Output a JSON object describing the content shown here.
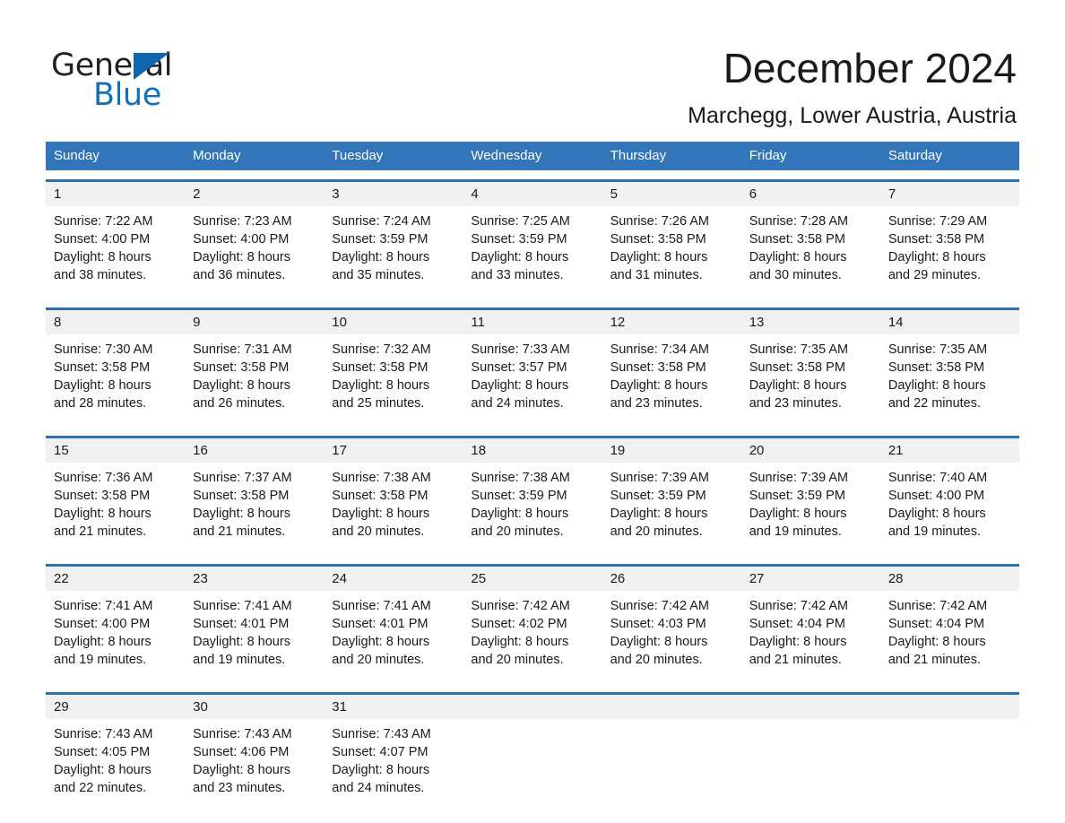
{
  "brand": {
    "word_one": "General",
    "word_two": "Blue",
    "triangle_icon": "triangle-icon",
    "accent_blue": "#1271bd",
    "dark_text": "#231f20"
  },
  "header": {
    "month_title": "December 2024",
    "location": "Marchegg, Lower Austria, Austria"
  },
  "theme": {
    "header_row_bg": "#3275b8",
    "week_rule": "#2e6fb0",
    "date_band_bg": "#f1f1f1",
    "page_bg": "#ffffff"
  },
  "weekdays": [
    "Sunday",
    "Monday",
    "Tuesday",
    "Wednesday",
    "Thursday",
    "Friday",
    "Saturday"
  ],
  "weeks": [
    [
      {
        "day": "1",
        "sunrise": "Sunrise: 7:22 AM",
        "sunset": "Sunset: 4:00 PM",
        "daylight1": "Daylight: 8 hours",
        "daylight2": "and 38 minutes."
      },
      {
        "day": "2",
        "sunrise": "Sunrise: 7:23 AM",
        "sunset": "Sunset: 4:00 PM",
        "daylight1": "Daylight: 8 hours",
        "daylight2": "and 36 minutes."
      },
      {
        "day": "3",
        "sunrise": "Sunrise: 7:24 AM",
        "sunset": "Sunset: 3:59 PM",
        "daylight1": "Daylight: 8 hours",
        "daylight2": "and 35 minutes."
      },
      {
        "day": "4",
        "sunrise": "Sunrise: 7:25 AM",
        "sunset": "Sunset: 3:59 PM",
        "daylight1": "Daylight: 8 hours",
        "daylight2": "and 33 minutes."
      },
      {
        "day": "5",
        "sunrise": "Sunrise: 7:26 AM",
        "sunset": "Sunset: 3:58 PM",
        "daylight1": "Daylight: 8 hours",
        "daylight2": "and 31 minutes."
      },
      {
        "day": "6",
        "sunrise": "Sunrise: 7:28 AM",
        "sunset": "Sunset: 3:58 PM",
        "daylight1": "Daylight: 8 hours",
        "daylight2": "and 30 minutes."
      },
      {
        "day": "7",
        "sunrise": "Sunrise: 7:29 AM",
        "sunset": "Sunset: 3:58 PM",
        "daylight1": "Daylight: 8 hours",
        "daylight2": "and 29 minutes."
      }
    ],
    [
      {
        "day": "8",
        "sunrise": "Sunrise: 7:30 AM",
        "sunset": "Sunset: 3:58 PM",
        "daylight1": "Daylight: 8 hours",
        "daylight2": "and 28 minutes."
      },
      {
        "day": "9",
        "sunrise": "Sunrise: 7:31 AM",
        "sunset": "Sunset: 3:58 PM",
        "daylight1": "Daylight: 8 hours",
        "daylight2": "and 26 minutes."
      },
      {
        "day": "10",
        "sunrise": "Sunrise: 7:32 AM",
        "sunset": "Sunset: 3:58 PM",
        "daylight1": "Daylight: 8 hours",
        "daylight2": "and 25 minutes."
      },
      {
        "day": "11",
        "sunrise": "Sunrise: 7:33 AM",
        "sunset": "Sunset: 3:57 PM",
        "daylight1": "Daylight: 8 hours",
        "daylight2": "and 24 minutes."
      },
      {
        "day": "12",
        "sunrise": "Sunrise: 7:34 AM",
        "sunset": "Sunset: 3:58 PM",
        "daylight1": "Daylight: 8 hours",
        "daylight2": "and 23 minutes."
      },
      {
        "day": "13",
        "sunrise": "Sunrise: 7:35 AM",
        "sunset": "Sunset: 3:58 PM",
        "daylight1": "Daylight: 8 hours",
        "daylight2": "and 23 minutes."
      },
      {
        "day": "14",
        "sunrise": "Sunrise: 7:35 AM",
        "sunset": "Sunset: 3:58 PM",
        "daylight1": "Daylight: 8 hours",
        "daylight2": "and 22 minutes."
      }
    ],
    [
      {
        "day": "15",
        "sunrise": "Sunrise: 7:36 AM",
        "sunset": "Sunset: 3:58 PM",
        "daylight1": "Daylight: 8 hours",
        "daylight2": "and 21 minutes."
      },
      {
        "day": "16",
        "sunrise": "Sunrise: 7:37 AM",
        "sunset": "Sunset: 3:58 PM",
        "daylight1": "Daylight: 8 hours",
        "daylight2": "and 21 minutes."
      },
      {
        "day": "17",
        "sunrise": "Sunrise: 7:38 AM",
        "sunset": "Sunset: 3:58 PM",
        "daylight1": "Daylight: 8 hours",
        "daylight2": "and 20 minutes."
      },
      {
        "day": "18",
        "sunrise": "Sunrise: 7:38 AM",
        "sunset": "Sunset: 3:59 PM",
        "daylight1": "Daylight: 8 hours",
        "daylight2": "and 20 minutes."
      },
      {
        "day": "19",
        "sunrise": "Sunrise: 7:39 AM",
        "sunset": "Sunset: 3:59 PM",
        "daylight1": "Daylight: 8 hours",
        "daylight2": "and 20 minutes."
      },
      {
        "day": "20",
        "sunrise": "Sunrise: 7:39 AM",
        "sunset": "Sunset: 3:59 PM",
        "daylight1": "Daylight: 8 hours",
        "daylight2": "and 19 minutes."
      },
      {
        "day": "21",
        "sunrise": "Sunrise: 7:40 AM",
        "sunset": "Sunset: 4:00 PM",
        "daylight1": "Daylight: 8 hours",
        "daylight2": "and 19 minutes."
      }
    ],
    [
      {
        "day": "22",
        "sunrise": "Sunrise: 7:41 AM",
        "sunset": "Sunset: 4:00 PM",
        "daylight1": "Daylight: 8 hours",
        "daylight2": "and 19 minutes."
      },
      {
        "day": "23",
        "sunrise": "Sunrise: 7:41 AM",
        "sunset": "Sunset: 4:01 PM",
        "daylight1": "Daylight: 8 hours",
        "daylight2": "and 19 minutes."
      },
      {
        "day": "24",
        "sunrise": "Sunrise: 7:41 AM",
        "sunset": "Sunset: 4:01 PM",
        "daylight1": "Daylight: 8 hours",
        "daylight2": "and 20 minutes."
      },
      {
        "day": "25",
        "sunrise": "Sunrise: 7:42 AM",
        "sunset": "Sunset: 4:02 PM",
        "daylight1": "Daylight: 8 hours",
        "daylight2": "and 20 minutes."
      },
      {
        "day": "26",
        "sunrise": "Sunrise: 7:42 AM",
        "sunset": "Sunset: 4:03 PM",
        "daylight1": "Daylight: 8 hours",
        "daylight2": "and 20 minutes."
      },
      {
        "day": "27",
        "sunrise": "Sunrise: 7:42 AM",
        "sunset": "Sunset: 4:04 PM",
        "daylight1": "Daylight: 8 hours",
        "daylight2": "and 21 minutes."
      },
      {
        "day": "28",
        "sunrise": "Sunrise: 7:42 AM",
        "sunset": "Sunset: 4:04 PM",
        "daylight1": "Daylight: 8 hours",
        "daylight2": "and 21 minutes."
      }
    ],
    [
      {
        "day": "29",
        "sunrise": "Sunrise: 7:43 AM",
        "sunset": "Sunset: 4:05 PM",
        "daylight1": "Daylight: 8 hours",
        "daylight2": "and 22 minutes."
      },
      {
        "day": "30",
        "sunrise": "Sunrise: 7:43 AM",
        "sunset": "Sunset: 4:06 PM",
        "daylight1": "Daylight: 8 hours",
        "daylight2": "and 23 minutes."
      },
      {
        "day": "31",
        "sunrise": "Sunrise: 7:43 AM",
        "sunset": "Sunset: 4:07 PM",
        "daylight1": "Daylight: 8 hours",
        "daylight2": "and 24 minutes."
      },
      {
        "day": "",
        "sunrise": "",
        "sunset": "",
        "daylight1": "",
        "daylight2": ""
      },
      {
        "day": "",
        "sunrise": "",
        "sunset": "",
        "daylight1": "",
        "daylight2": ""
      },
      {
        "day": "",
        "sunrise": "",
        "sunset": "",
        "daylight1": "",
        "daylight2": ""
      },
      {
        "day": "",
        "sunrise": "",
        "sunset": "",
        "daylight1": "",
        "daylight2": ""
      }
    ]
  ]
}
